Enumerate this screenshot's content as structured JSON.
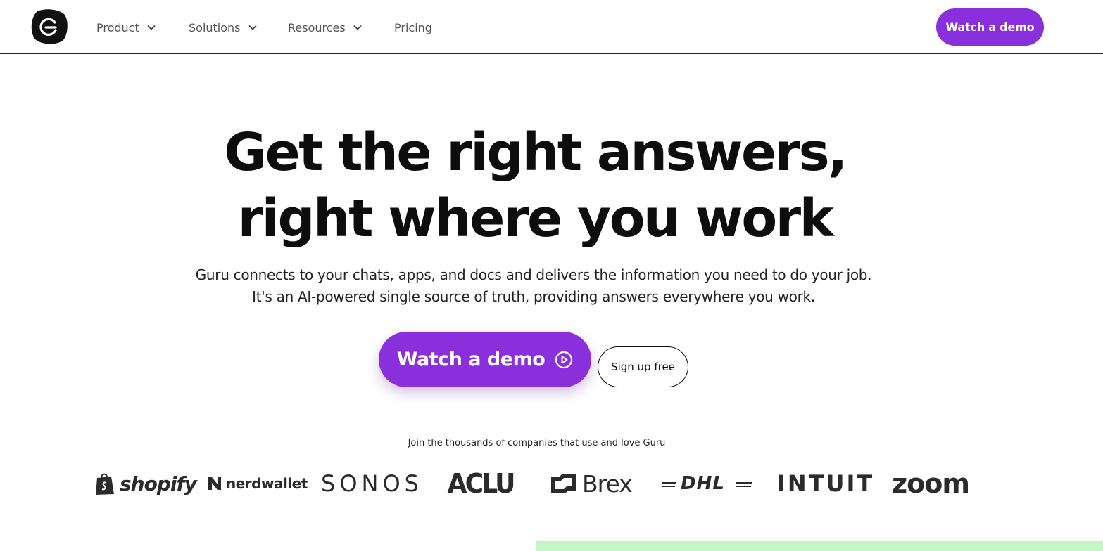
{
  "nav": {
    "logo_icon": "guru-logo-icon",
    "items": [
      {
        "label": "Product",
        "has_dropdown": true
      },
      {
        "label": "Solutions",
        "has_dropdown": true
      },
      {
        "label": "Resources",
        "has_dropdown": true
      },
      {
        "label": "Pricing",
        "has_dropdown": false
      }
    ],
    "cta_label": "Watch a demo"
  },
  "hero": {
    "title_line1": "Get the right answers,",
    "title_line2": "right where you work",
    "subtitle_line1": "Guru connects to your chats, apps, and docs and delivers the information you need to do your job.",
    "subtitle_line2": "It's an AI-powered single source of truth, providing answers everywhere you work.",
    "primary_cta": "Watch a demo",
    "primary_cta_icon": "play-circle-icon",
    "secondary_cta": "Sign up free"
  },
  "trust": {
    "text": "Join the thousands of companies that use and love Guru",
    "logos": [
      "shopify",
      "nerdwallet",
      "SONOS",
      "ACLU",
      "Brex",
      "DHL",
      "INTUIT",
      "zoom"
    ]
  },
  "colors": {
    "accent": "#8a2fdc",
    "text": "#0d0d0d",
    "muted": "#555555",
    "green_section": "#c4f5c6"
  }
}
